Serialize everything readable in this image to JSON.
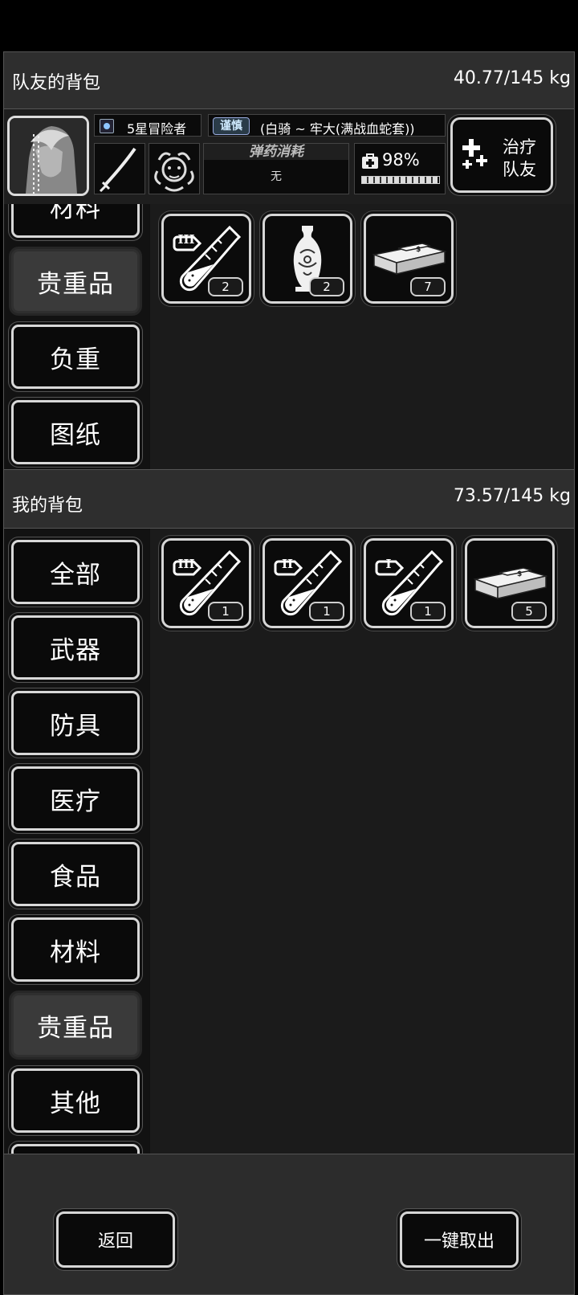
{
  "teammate_bag": {
    "title": "队友的背包",
    "weight": "40.77/145 kg"
  },
  "character": {
    "rank": "5星冒险者",
    "tag": "谨慎",
    "name": "(白骑 ~ 牢大(满战血蛇套))",
    "ammo_title": "弹药消耗",
    "ammo_value": "无",
    "health": "98%",
    "health_fraction": 0.98,
    "heal_label_1": "治疗",
    "heal_label_2": "队友"
  },
  "teammate_categories": [
    {
      "label": "材料"
    },
    {
      "label": "贵重品",
      "active": true
    },
    {
      "label": "负重"
    },
    {
      "label": "图纸"
    }
  ],
  "teammate_items": [
    {
      "icon": "test-tube-iii-icon",
      "tier": "III",
      "count": "2"
    },
    {
      "icon": "porcelain-vase-icon",
      "count": "2"
    },
    {
      "icon": "cash-bundle-icon",
      "count": "7"
    }
  ],
  "my_bag": {
    "title": "我的背包",
    "weight": "73.57/145 kg"
  },
  "my_categories": [
    {
      "label": "全部"
    },
    {
      "label": "武器"
    },
    {
      "label": "防具"
    },
    {
      "label": "医疗"
    },
    {
      "label": "食品"
    },
    {
      "label": "材料"
    },
    {
      "label": "贵重品",
      "active": true
    },
    {
      "label": "其他"
    }
  ],
  "my_items": [
    {
      "icon": "test-tube-iii-icon",
      "tier": "III",
      "count": "1"
    },
    {
      "icon": "test-tube-ii-icon",
      "tier": "II",
      "count": "1"
    },
    {
      "icon": "test-tube-i-icon",
      "tier": "I",
      "count": "1"
    },
    {
      "icon": "cash-bundle-icon",
      "count": "5"
    }
  ],
  "footer": {
    "back_label": "返回",
    "take_all_label": "一键取出"
  }
}
